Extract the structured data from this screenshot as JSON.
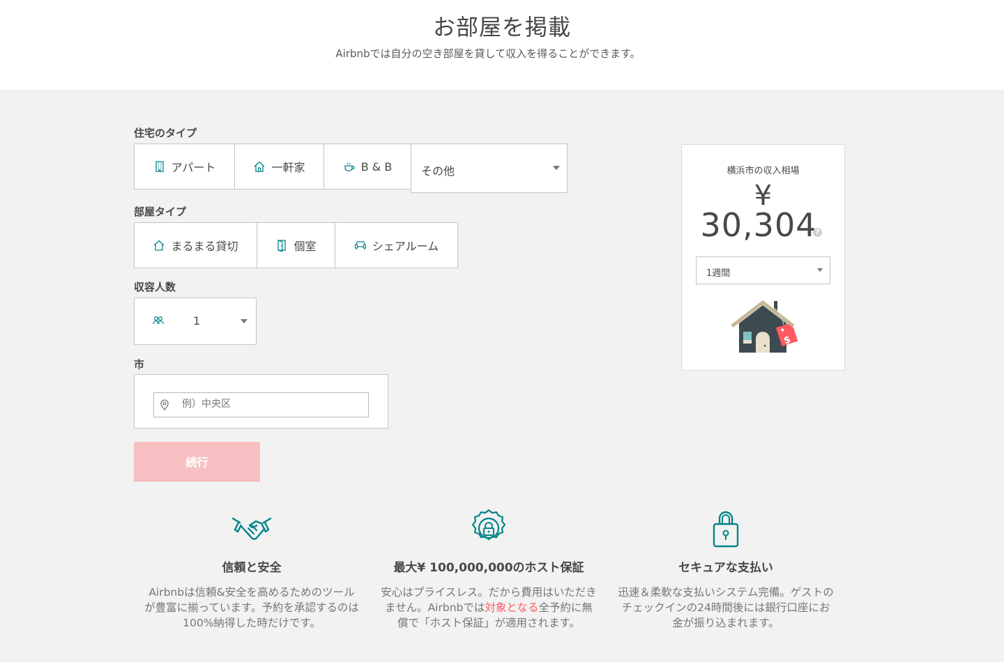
{
  "hero": {
    "title": "お部屋を掲載",
    "subtitle": "Airbnbでは自分の空き部屋を貸して収入を得ることができます。"
  },
  "form": {
    "home_type_label": "住宅のタイプ",
    "home_types": [
      {
        "label": "アパート",
        "icon": "building-icon"
      },
      {
        "label": "一軒家",
        "icon": "house-icon"
      },
      {
        "label": "B & B",
        "icon": "cup-icon"
      }
    ],
    "home_type_other": "その他",
    "room_type_label": "部屋タイプ",
    "room_types": [
      {
        "label": "まるまる貸切",
        "icon": "house-icon"
      },
      {
        "label": "個室",
        "icon": "door-icon"
      },
      {
        "label": "シェアルーム",
        "icon": "sofa-icon"
      }
    ],
    "guests_label": "収容人数",
    "guests_value": "1",
    "city_label": "市",
    "city_placeholder": "例）中央区",
    "continue_label": "続行"
  },
  "earnings": {
    "city_text": "横浜市の収入相場",
    "currency": "¥",
    "amount": "30,304",
    "help": "?",
    "period": "1週間"
  },
  "features": [
    {
      "icon": "handshake-icon",
      "title": "信頼と安全",
      "body": "Airbnbは信頼&安全を高めるためのツールが豊富に揃っています。予約を承認するのは100%納得した時だけです。"
    },
    {
      "icon": "badge-icon",
      "title": "最大¥ 100,000,000のホスト保証",
      "body_pre": "安心はプライスレス。だから費用はいただきません。Airbnbでは",
      "body_highlight": "対象となる",
      "body_post": "全予約に無償で「ホスト保証」が適用されます。"
    },
    {
      "icon": "lock-icon",
      "title": "セキュアな支払い",
      "body": "迅速＆柔軟な支払いシステム完備。ゲストのチェックインの24時間後には銀行口座にお金が振り込まれます。"
    }
  ],
  "colors": {
    "accent": "#008489",
    "brand": "#ff5a5f",
    "button_disabled": "#f8c0c2",
    "background": "#f2f2f2"
  }
}
